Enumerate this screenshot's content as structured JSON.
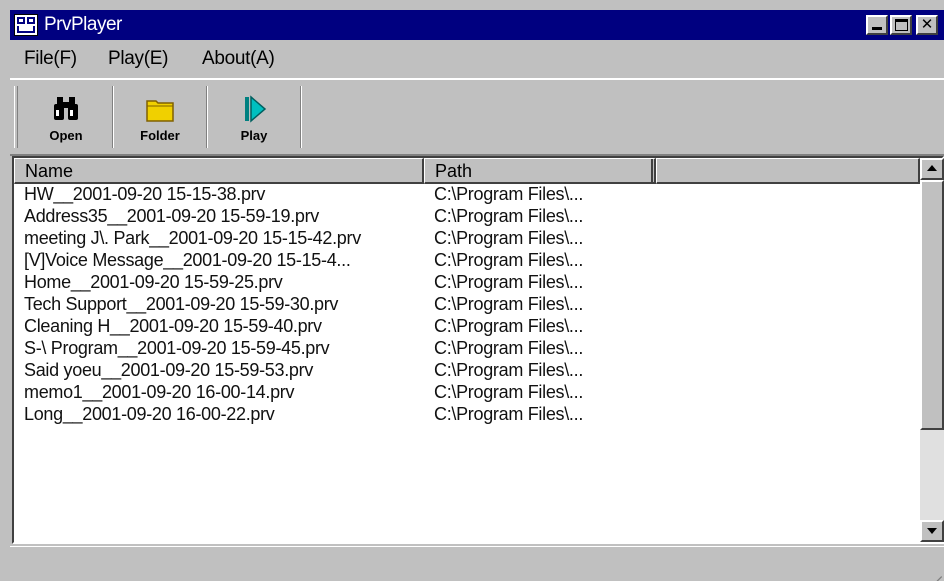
{
  "window": {
    "title": "PrvPlayer",
    "colors": {
      "titlebar": "#000080",
      "face": "#c0c0c0",
      "list_bg": "#ffffff"
    }
  },
  "menu": {
    "items": [
      {
        "label": "File(F)"
      },
      {
        "label": "Play(E)"
      },
      {
        "label": "About(A)"
      }
    ]
  },
  "toolbar": {
    "buttons": [
      {
        "label": "Open",
        "icon": "binoculars-icon"
      },
      {
        "label": "Folder",
        "icon": "folder-icon"
      },
      {
        "label": "Play",
        "icon": "play-icon"
      }
    ]
  },
  "list": {
    "columns": [
      "Name",
      "Path",
      ""
    ],
    "rows": [
      {
        "name": "HW__2001-09-20 15-15-38.prv",
        "path": "C:\\Program Files\\..."
      },
      {
        "name": "Address35__2001-09-20 15-59-19.prv",
        "path": "C:\\Program Files\\..."
      },
      {
        "name": "meeting J\\. Park__2001-09-20 15-15-42.prv",
        "path": "C:\\Program Files\\..."
      },
      {
        "name": "[V]Voice Message__2001-09-20 15-15-4...",
        "path": "C:\\Program Files\\..."
      },
      {
        "name": "Home__2001-09-20 15-59-25.prv",
        "path": "C:\\Program Files\\..."
      },
      {
        "name": "Tech Support__2001-09-20 15-59-30.prv",
        "path": "C:\\Program Files\\..."
      },
      {
        "name": "Cleaning H__2001-09-20 15-59-40.prv",
        "path": "C:\\Program Files\\..."
      },
      {
        "name": "S-\\ Program__2001-09-20 15-59-45.prv",
        "path": "C:\\Program Files\\..."
      },
      {
        "name": "Said yoeu__2001-09-20 15-59-53.prv",
        "path": "C:\\Program Files\\..."
      },
      {
        "name": "memo1__2001-09-20 16-00-14.prv",
        "path": "C:\\Program Files\\..."
      },
      {
        "name": "Long__2001-09-20 16-00-22.prv",
        "path": "C:\\Program Files\\..."
      }
    ]
  }
}
